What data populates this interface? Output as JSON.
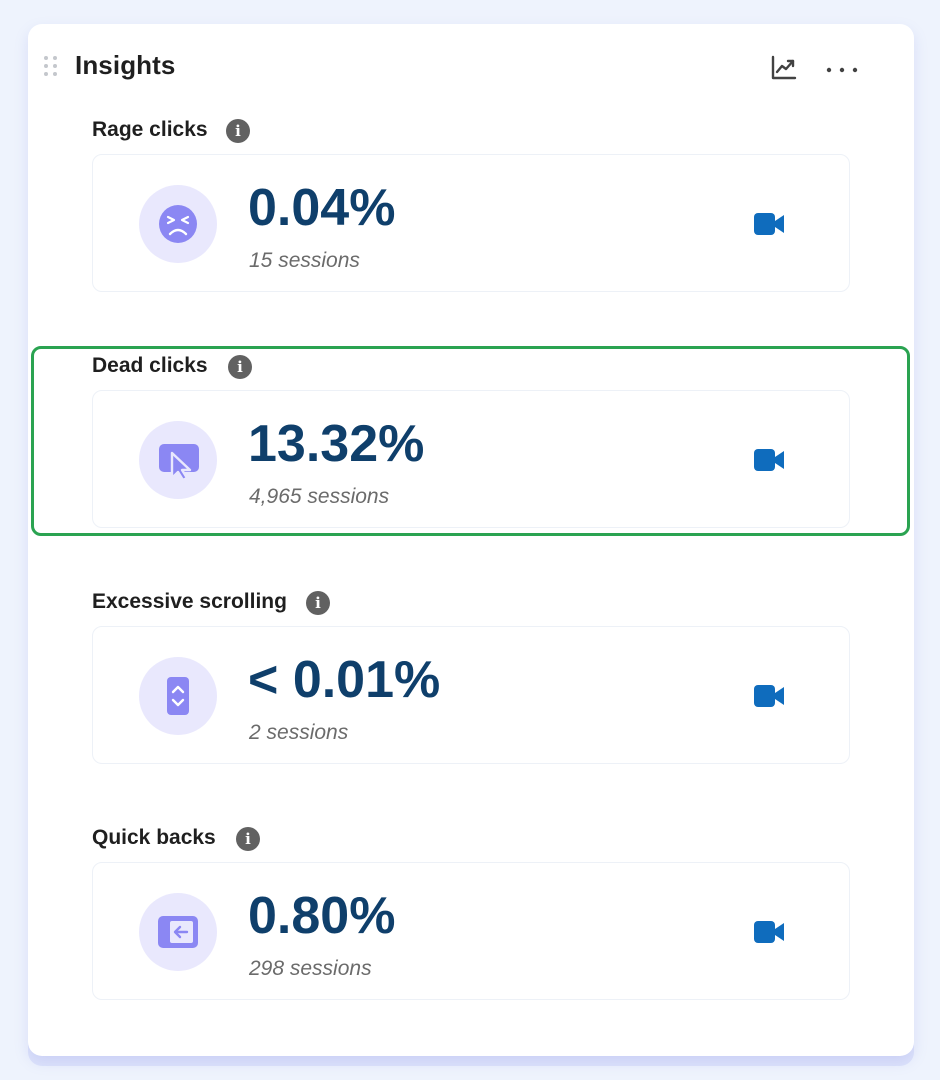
{
  "header": {
    "title": "Insights",
    "chart_icon": "chart-trend-icon",
    "more_icon": "more-horizontal-icon"
  },
  "colors": {
    "accent": "#0f6cbd",
    "value_text": "#0f3f6b",
    "icon_bg": "#e9e8fd",
    "icon_fg": "#8b87f3",
    "highlight": "#2aa351"
  },
  "insights": [
    {
      "label": "Rage clicks",
      "value": "0.04%",
      "sessions": "15 sessions",
      "icon": "angry-face-icon"
    },
    {
      "label": "Dead clicks",
      "value": "13.32%",
      "sessions": "4,965 sessions",
      "icon": "dead-click-cursor-icon"
    },
    {
      "label": "Excessive scrolling",
      "value": "< 0.01%",
      "sessions": "2 sessions",
      "icon": "scroll-icon"
    },
    {
      "label": "Quick backs",
      "value": "0.80%",
      "sessions": "298 sessions",
      "icon": "quick-back-icon"
    }
  ]
}
